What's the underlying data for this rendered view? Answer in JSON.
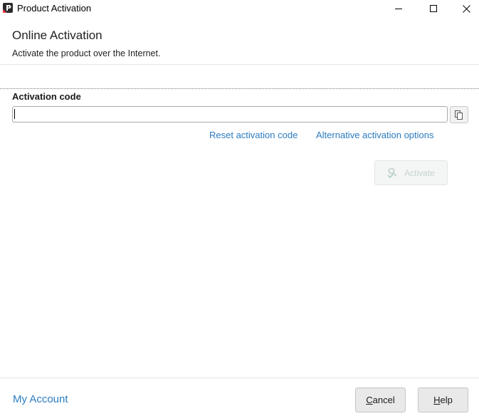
{
  "window": {
    "title": "Product Activation"
  },
  "header": {
    "title": "Online Activation",
    "subtitle": "Activate the product over the Internet."
  },
  "activation": {
    "label": "Activation code",
    "value": "",
    "placeholder": "",
    "paste_icon": "paste-icon",
    "reset_link": "Reset activation code",
    "alt_link": "Alternative activation options",
    "activate_button": "Activate",
    "activate_icon": "key-check-icon",
    "activate_enabled": false
  },
  "footer": {
    "account_link": "My Account",
    "cancel_label": "Cancel",
    "help_label": "Help"
  },
  "colors": {
    "link": "#2b7cc0",
    "app_icon_dark": "#2b2b2b",
    "app_icon_accent": "#e03a4a"
  }
}
